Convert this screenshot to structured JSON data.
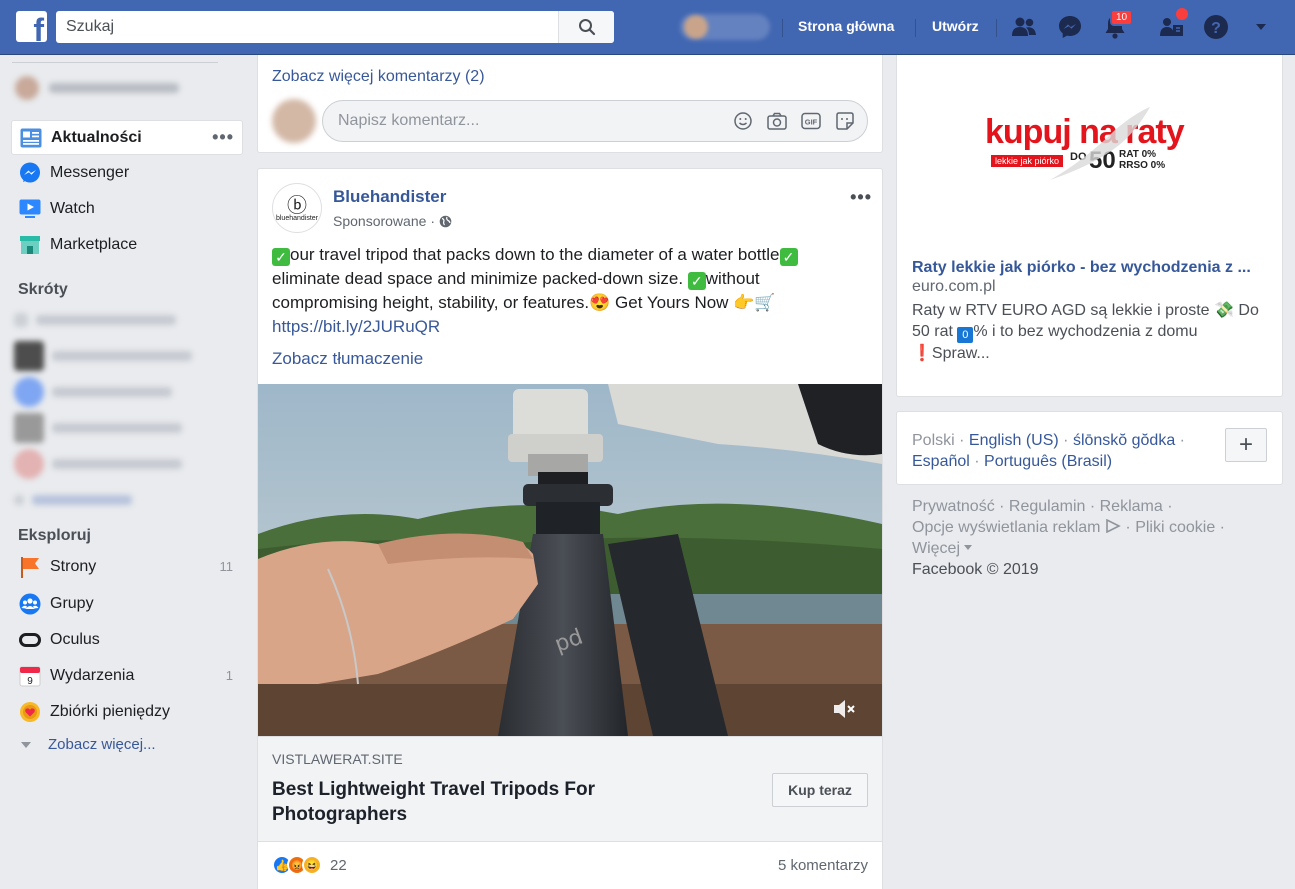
{
  "header": {
    "search_placeholder": "Szukaj",
    "home_label": "Strona główna",
    "create_label": "Utwórz",
    "notifications_count": "10",
    "accent": "#4267b2"
  },
  "sidebar": {
    "main_items": [
      {
        "label": "Aktualności",
        "icon": "news-feed-icon"
      },
      {
        "label": "Messenger",
        "icon": "messenger-icon"
      },
      {
        "label": "Watch",
        "icon": "watch-icon"
      },
      {
        "label": "Marketplace",
        "icon": "marketplace-icon"
      }
    ],
    "shortcuts_title": "Skróty",
    "explore_title": "Eksploruj",
    "explore_items": [
      {
        "label": "Strony",
        "count": "11",
        "icon": "pages-flag-icon"
      },
      {
        "label": "Grupy",
        "count": "",
        "icon": "groups-icon"
      },
      {
        "label": "Oculus",
        "count": "",
        "icon": "oculus-icon"
      },
      {
        "label": "Wydarzenia",
        "count": "1",
        "icon": "calendar-icon"
      },
      {
        "label": "Zbiórki pieniędzy",
        "count": "",
        "icon": "fundraiser-icon"
      }
    ],
    "see_more": "Zobacz więcej..."
  },
  "top_card": {
    "more_comments": "Zobacz więcej komentarzy (2)",
    "comment_placeholder": "Napisz komentarz..."
  },
  "post": {
    "page_name": "Bluehandister",
    "logo_text": "bluehandister",
    "sponsored": "Sponsorowane",
    "text_line1": "our travel tripod that packs down to the diameter of a water bottle",
    "text_line2": "eliminate dead space and minimize packed-down size. ",
    "text_line2b": "without",
    "text_line3": "compromising height, stability, or features.",
    "text_line3b": " Get Yours Now ",
    "link": "https://bit.ly/2JURuQR",
    "translate": "Zobacz tłumaczenie",
    "ad_domain": "VISTLAWERAT.SITE",
    "ad_title": "Best Lightweight Travel Tripods For Photographers",
    "cta": "Kup teraz",
    "reactions_count": "22",
    "comments_count": "5 komentarzy"
  },
  "right_ad": {
    "logo_main": "kupuj na raty",
    "logo_tag": "lekkie jak piórko",
    "logo_do": "DO",
    "logo_50": "50",
    "logo_rat": "RAT 0%",
    "logo_rrso": "RRSO 0%",
    "title": "Raty lekkie jak piórko - bez wychodzenia z ...",
    "domain": "euro.com.pl",
    "body1": "Raty w RTV EURO AGD są lekkie i proste ",
    "body2": " Do 50 rat ",
    "body_zero": "0",
    "body3": "% i to bez wychodzenia z domu ",
    "body4": "Spraw..."
  },
  "languages": {
    "items": [
      "Polski",
      "English (US)",
      "ślōnskŏ gŏdka",
      "Español",
      "Português (Brasil)"
    ],
    "add_label": "+"
  },
  "footer": {
    "links": [
      "Prywatność",
      "Regulamin",
      "Reklama",
      "Opcje wyświetlania reklam",
      "Pliki cookie",
      "Więcej"
    ],
    "copyright": "Facebook © 2019"
  }
}
